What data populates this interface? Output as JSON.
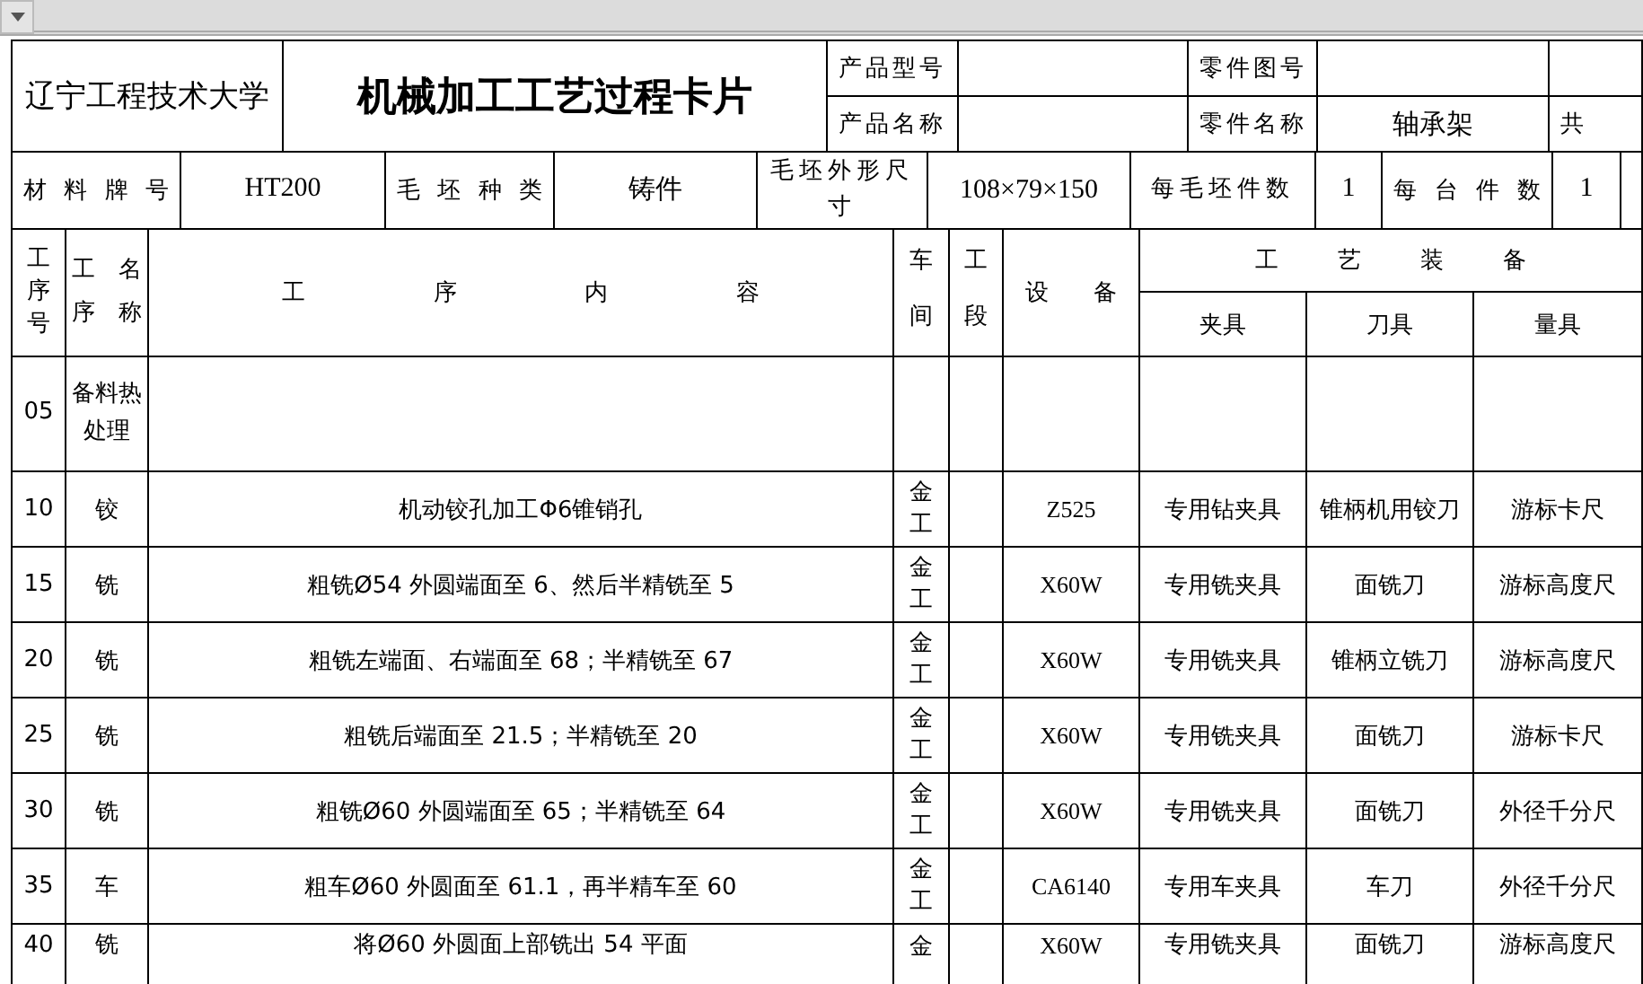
{
  "card": {
    "school": "辽宁工程技术大学",
    "title": "机械加工工艺过程卡片",
    "product_model_label": "产品型号",
    "part_drawing_label": "零件图号",
    "product_name_label": "产品名称",
    "part_name_label": "零件名称",
    "part_name": "轴承架",
    "total_label": "共"
  },
  "blank": {
    "material_label": "材料牌号",
    "material": "HT200",
    "blank_type_label": "毛坯种类",
    "blank_type": "铸件",
    "blank_size_label": "毛坯外形尺寸",
    "blank_size": "108×79×150",
    "per_blank_label": "每毛坯件数",
    "per_blank": "1",
    "per_unit_label": "每台件数",
    "per_unit": "1"
  },
  "table": {
    "columns": {
      "no": "工序号",
      "name": "工序名称",
      "content": "工序内容",
      "workshop": "车间",
      "section": "工段",
      "equipment": "设备",
      "tooling": "工艺装备",
      "fixture": "夹具",
      "tool": "刀具",
      "gauge": "量具"
    },
    "rows": [
      {
        "no": "05",
        "name": "备料热处理"
      },
      {
        "no": "10",
        "name": "铰",
        "content": "机动铰孔加工Φ6锥销孔",
        "workshop": "金工",
        "equipment": "Z525",
        "fixture": "专用钻夹具",
        "tool": "锥柄机用铰刀",
        "gauge": "游标卡尺"
      },
      {
        "no": "15",
        "name": "铣",
        "content": "粗铣Ø54 外圆端面至 6、然后半精铣至 5",
        "workshop": "金工",
        "equipment": "X60W",
        "fixture": "专用铣夹具",
        "tool": "面铣刀",
        "gauge": "游标高度尺"
      },
      {
        "no": "20",
        "name": "铣",
        "content": "粗铣左端面、右端面至 68；半精铣至 67",
        "workshop": "金工",
        "equipment": "X60W",
        "fixture": "专用铣夹具",
        "tool": "锥柄立铣刀",
        "gauge": "游标高度尺"
      },
      {
        "no": "25",
        "name": "铣",
        "content": "粗铣后端面至 21.5；半精铣至 20",
        "workshop": "金工",
        "equipment": "X60W",
        "fixture": "专用铣夹具",
        "tool": "面铣刀",
        "gauge": "游标卡尺"
      },
      {
        "no": "30",
        "name": "铣",
        "content": "粗铣Ø60 外圆端面至 65；半精铣至 64",
        "workshop": "金工",
        "equipment": "X60W",
        "fixture": "专用铣夹具",
        "tool": "面铣刀",
        "gauge": "外径千分尺"
      },
      {
        "no": "35",
        "name": "车",
        "content": "粗车Ø60 外圆面至 61.1，再半精车至 60",
        "workshop": "金工",
        "equipment": "CA6140",
        "fixture": "专用车夹具",
        "tool": "车刀",
        "gauge": "外径千分尺"
      },
      {
        "no": "40",
        "name": "铣",
        "content": "将Ø60 外圆面上部铣出 54 平面",
        "workshop": "金",
        "equipment": "X60W",
        "fixture": "专用铣夹具",
        "tool": "面铣刀",
        "gauge": "游标高度尺"
      }
    ]
  }
}
